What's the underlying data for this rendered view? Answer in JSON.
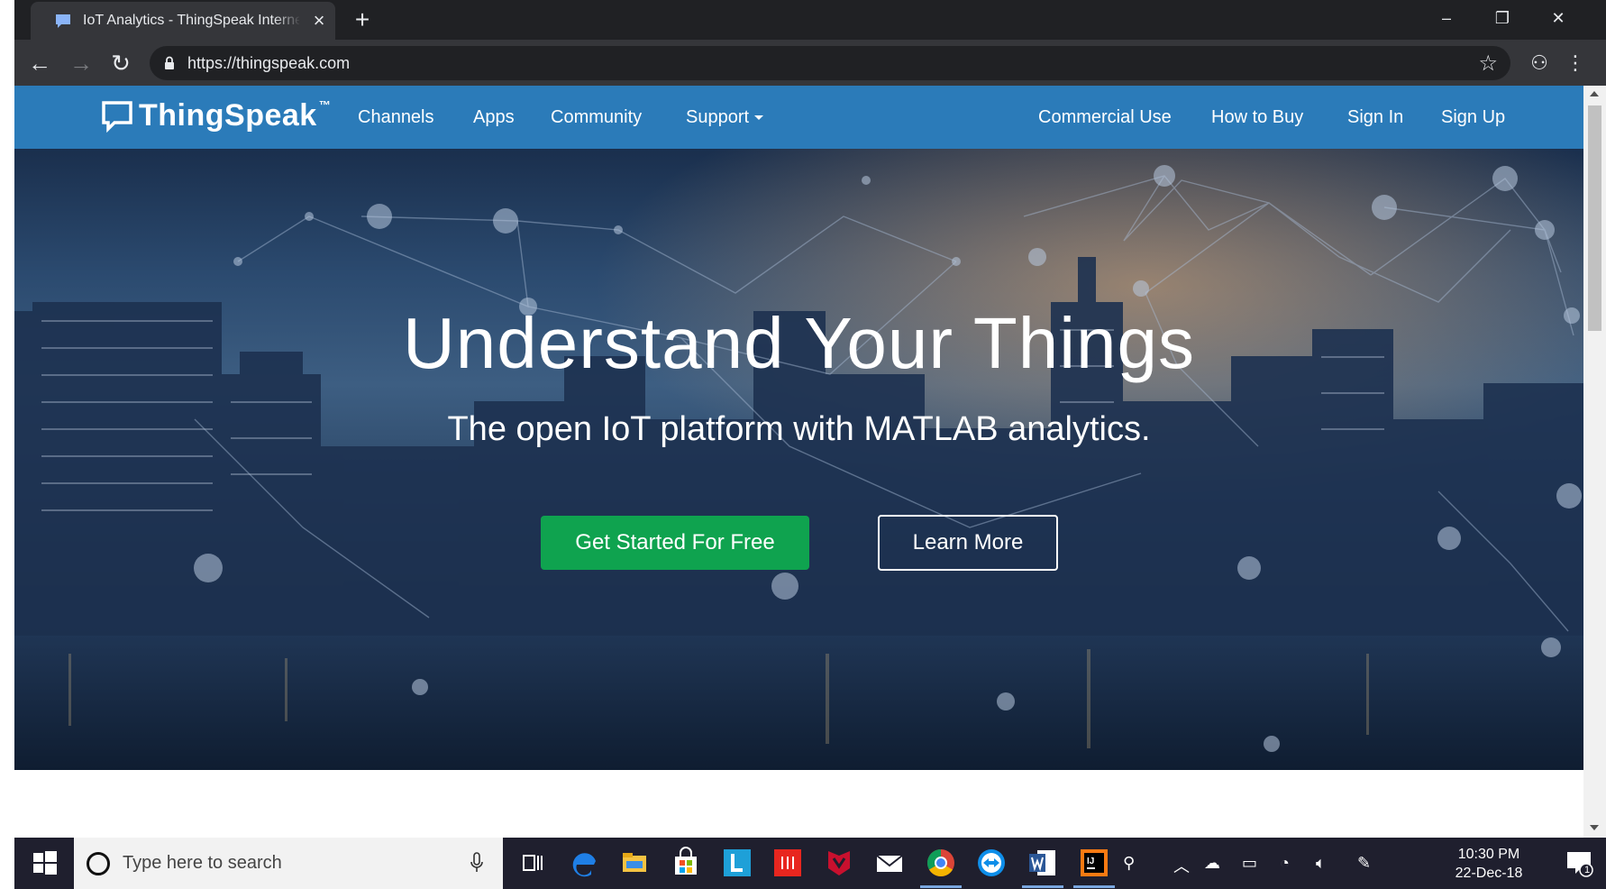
{
  "browser": {
    "tab_title": "IoT Analytics - ThingSpeak Internet of Things",
    "tab_close": "×",
    "new_tab": "+",
    "url": "https://thingspeak.com",
    "window_controls": {
      "minimize": "–",
      "restore": "❐",
      "close": "✕"
    }
  },
  "site": {
    "brand": "ThingSpeak",
    "brand_tm": "™",
    "nav_left": [
      "Channels",
      "Apps",
      "Community",
      "Support"
    ],
    "nav_right": [
      "Commercial Use",
      "How to Buy",
      "Sign In",
      "Sign Up"
    ],
    "hero": {
      "title": "Understand Your Things",
      "subtitle": "The open IoT platform with MATLAB analytics.",
      "primary_button": "Get Started For Free",
      "secondary_button": "Learn More"
    },
    "colors": {
      "nav_bg": "#2b7bb9",
      "primary_green": "#0fa34f"
    }
  },
  "taskbar": {
    "search_placeholder": "Type here to search",
    "time": "10:30 PM",
    "date": "22-Dec-18",
    "notification_count": "1",
    "apps": [
      "task-view",
      "edge",
      "file-explorer",
      "store",
      "l-app",
      "red-app",
      "mcafee",
      "mail",
      "chrome",
      "teamviewer",
      "word",
      "intellij"
    ]
  }
}
